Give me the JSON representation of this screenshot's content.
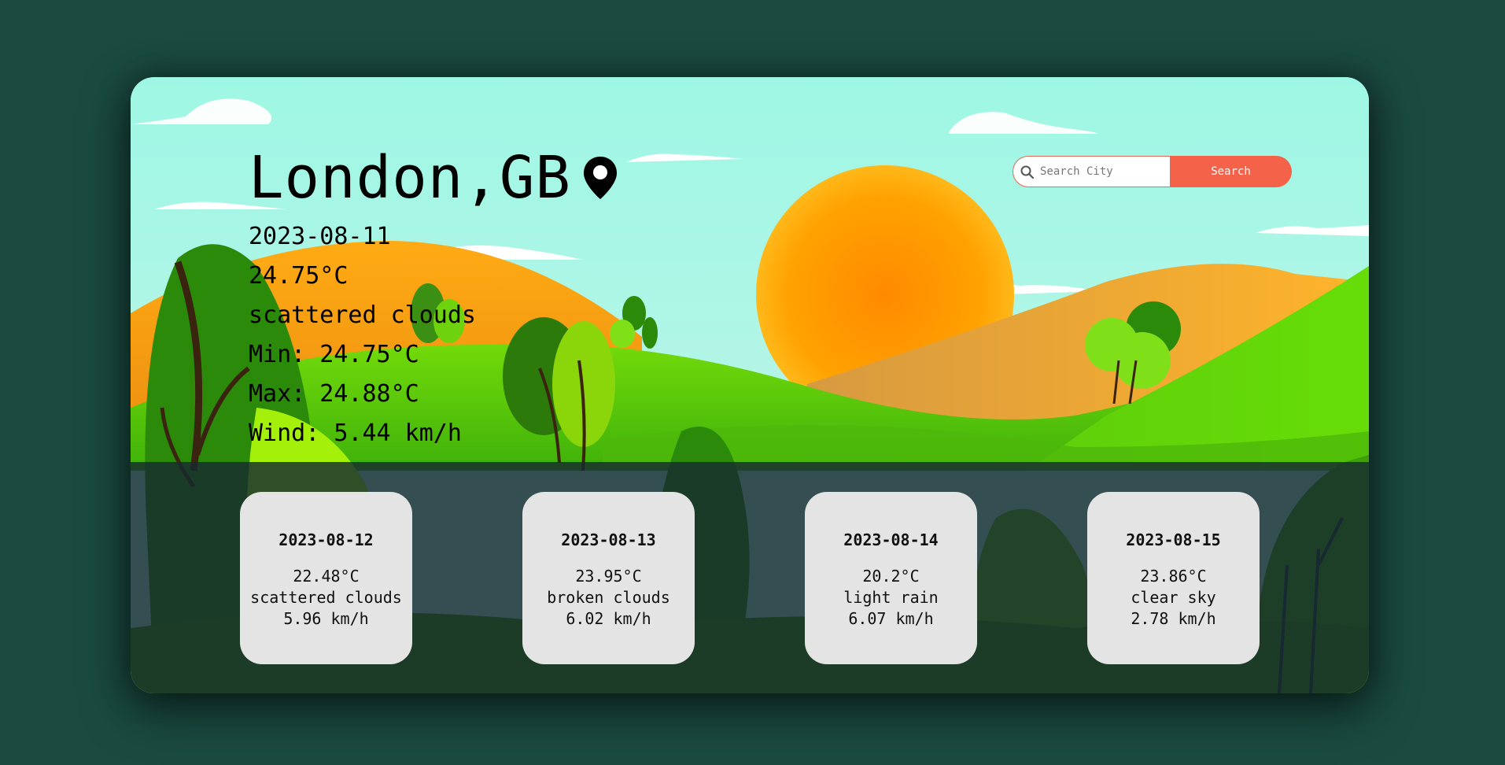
{
  "location": {
    "city_title": "London,GB",
    "pin_icon": "location-pin-icon"
  },
  "current": {
    "date": "2023-08-11",
    "temperature": "24.75°C",
    "description": "scattered clouds",
    "min": "Min: 24.75°C",
    "max": "Max: 24.88°C",
    "wind": "Wind: 5.44 km/h"
  },
  "search": {
    "placeholder": "Search City",
    "button_label": "Search",
    "icon": "search-icon",
    "button_color": "#f4624a"
  },
  "forecast": [
    {
      "date": "2023-08-12",
      "temp": "22.48°C",
      "description": "scattered clouds",
      "wind": "5.96 km/h"
    },
    {
      "date": "2023-08-13",
      "temp": "23.95°C",
      "description": "broken clouds",
      "wind": "6.02 km/h"
    },
    {
      "date": "2023-08-14",
      "temp": "20.2°C",
      "description": "light rain",
      "wind": "6.07 km/h"
    },
    {
      "date": "2023-08-15",
      "temp": "23.86°C",
      "description": "clear sky",
      "wind": "2.78 km/h"
    }
  ],
  "colors": {
    "page_background": "#1a4a40",
    "sky": "#9ff5e3",
    "sun": "#ffa000",
    "card_background": "#e4e4e4"
  }
}
